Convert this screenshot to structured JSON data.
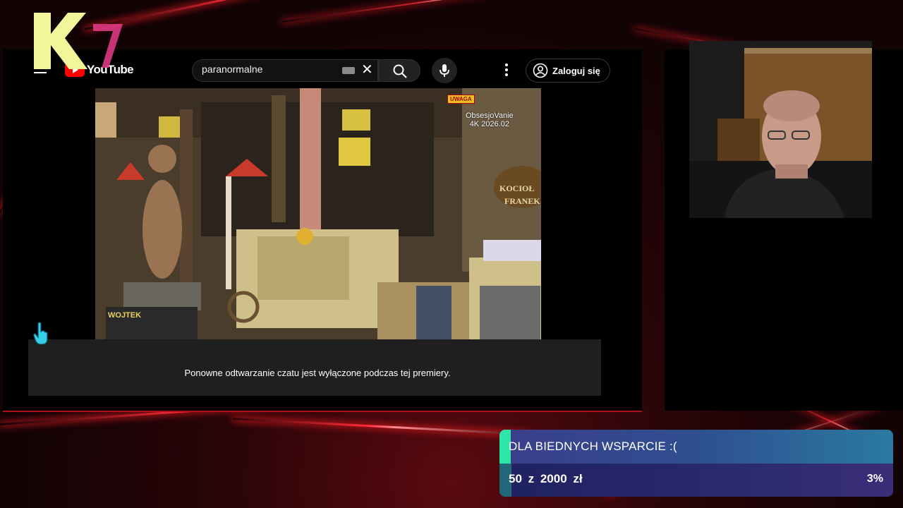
{
  "youtube": {
    "logo_text": "YouTube",
    "search_value": "paranormalne",
    "signin_label": "Zaloguj się",
    "chat_disabled_message": "Ponowne odtwarzanie czatu jest wyłączone podczas tej premiery."
  },
  "video": {
    "overlay_line1": "ObsesjoVanie",
    "overlay_line2": "4K 2026.02",
    "sign_uwaga": "UWAGA",
    "sign_wojtek": "WOJTEK",
    "sign_kociol": "KOCIOŁ",
    "sign_franek": "FRANEK"
  },
  "donation_goal": {
    "title": "DLA BIEDNYCH WSPARCIE :(",
    "amount_text": "50 z 2000 zł",
    "percent_text": "3%",
    "progress_fraction": 0.03,
    "accent_color": "#2ee6a8"
  },
  "branding": {
    "logo_letter": "K",
    "logo_number": "7",
    "logo_color": "#f2f59a",
    "logo_number_color": "#e83c8a"
  }
}
